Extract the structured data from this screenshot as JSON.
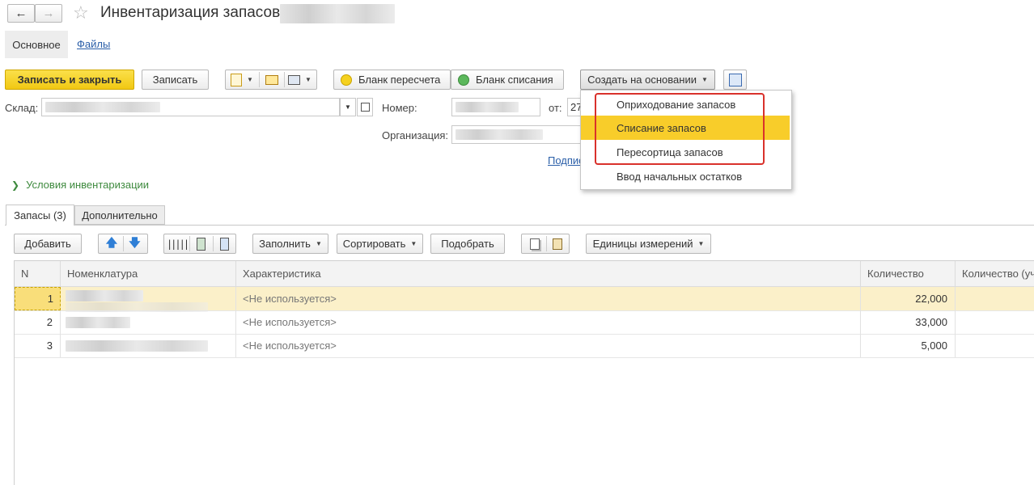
{
  "title": {
    "text": "Инвентаризация запасов"
  },
  "tabs_top": {
    "main": "Основное",
    "files": "Файлы"
  },
  "toolbar": {
    "save_close": "Записать и закрыть",
    "save": "Записать",
    "blank_recount": "Бланк пересчета",
    "blank_writeoff": "Бланк списания",
    "create_based": "Создать на основании"
  },
  "form": {
    "warehouse_label": "Склад:",
    "number_label": "Номер:",
    "from_label": "от:",
    "date_partial": "27",
    "org_label": "Организация:",
    "link_partial": "Подпис"
  },
  "dropdown": {
    "items": [
      "Оприходование запасов",
      "Списание запасов",
      "Пересортица запасов",
      "Ввод начальных остатков"
    ]
  },
  "conditions": {
    "label": "Условия инвентаризации"
  },
  "inner_tabs": {
    "stock": "Запасы (3)",
    "extra": "Дополнительно"
  },
  "table_toolbar": {
    "add": "Добавить",
    "fill": "Заполнить",
    "sort": "Сортировать",
    "pick": "Подобрать",
    "units": "Единицы измерений"
  },
  "table": {
    "headers": [
      "N",
      "Номенклатура",
      "Характеристика",
      "Количество",
      "Количество (уч"
    ],
    "rows": [
      {
        "n": "1",
        "char": "<Не используется>",
        "qty": "22,000"
      },
      {
        "n": "2",
        "char": "<Не используется>",
        "qty": "33,000"
      },
      {
        "n": "3",
        "char": "<Не используется>",
        "qty": "5,000"
      }
    ]
  },
  "colors": {
    "accent_yellow": "#f5d11f",
    "highlight_red": "#d9312b",
    "link_blue": "#2a5ea8",
    "green_text": "#3e8a3e",
    "selected_row": "#fbf0c9"
  }
}
